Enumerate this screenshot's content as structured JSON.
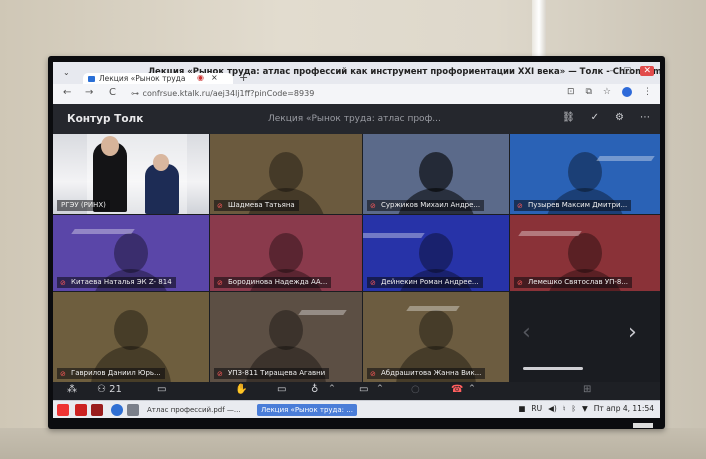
{
  "browser": {
    "window_title": "Лекция «Рынок труда: атлас профессий как инструмент профориентации XXI века» — Толк - Chromium",
    "tab_title": "Лекция «Рынок труда",
    "tab_close": "×",
    "new_tab": "+",
    "url": "confrsue.ktalk.ru/aej34lj1ff?pinCode=8939",
    "nav": {
      "back": "←",
      "forward": "→",
      "reload": "C"
    }
  },
  "app": {
    "brand": "Контур Толк",
    "meeting_title": "Лекция «Рынок труда: атлас проф...",
    "participant_count": "21"
  },
  "participants": [
    {
      "name": "РГЭУ (РИНХ)",
      "color": "#bfc3ca",
      "muted": false
    },
    {
      "name": "Шадмева Татьяна",
      "color": "#6b5a3e",
      "muted": true
    },
    {
      "name": "Суржиков Михаил Андре...",
      "color": "#5b6a8a",
      "muted": true
    },
    {
      "name": "Пузырев Максим Дмитри...",
      "color": "#2a62b6",
      "muted": true
    },
    {
      "name": "Китаева Наталья ЭК Z- 814",
      "color": "#5a46a8",
      "muted": true
    },
    {
      "name": "Бородинова Надежда АА...",
      "color": "#8a3a4c",
      "muted": true
    },
    {
      "name": "Дейнекин Роман Андрее...",
      "color": "#2733a8",
      "muted": true
    },
    {
      "name": "Лемешко Святослав УП-8...",
      "color": "#8a3238",
      "muted": true
    },
    {
      "name": "Гаврилов Даниил Юрь...",
      "color": "#6e5e3e",
      "muted": true
    },
    {
      "name": "УПЗ-811 Тиращева Агавни",
      "color": "#5c4f44",
      "muted": true
    },
    {
      "name": "Абдрашитова Жанна Вик...",
      "color": "#6c5c40",
      "muted": true
    }
  ],
  "taskbar": {
    "items": [
      "Атлас профессий.pdf —...",
      "Лекция «Рынок труда: ..."
    ],
    "lang": "RU",
    "clock": "Пт апр 4, 11:54"
  }
}
